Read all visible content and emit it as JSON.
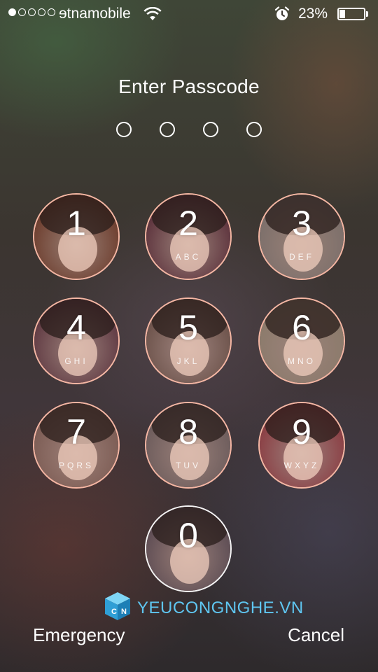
{
  "status_bar": {
    "carrier": "ɘtnamobile",
    "battery_percent": "23%",
    "battery_level": 0.23,
    "signal_bars_filled": 1,
    "signal_bars_total": 5,
    "icons": [
      "wifi-icon",
      "alarm-icon",
      "battery-icon"
    ]
  },
  "title": "Enter Passcode",
  "passcode": {
    "length": 4,
    "entered": 0
  },
  "keypad": [
    {
      "digit": "1",
      "letters": ""
    },
    {
      "digit": "2",
      "letters": "ABC"
    },
    {
      "digit": "3",
      "letters": "DEF"
    },
    {
      "digit": "4",
      "letters": "GHI"
    },
    {
      "digit": "5",
      "letters": "JKL"
    },
    {
      "digit": "6",
      "letters": "MNO"
    },
    {
      "digit": "7",
      "letters": "PQRS"
    },
    {
      "digit": "8",
      "letters": "TUV"
    },
    {
      "digit": "9",
      "letters": "WXYZ"
    },
    {
      "digit": "0",
      "letters": ""
    }
  ],
  "watermark": "YEUCONGNGHE.VN",
  "buttons": {
    "emergency": "Emergency",
    "cancel": "Cancel"
  },
  "colors": {
    "key_ring": "#ffbeaa",
    "watermark": "#5fc6f1",
    "photo_tints": [
      "#6b3a2a",
      "#5a2f3a",
      "#7a6e6a",
      "#5d3640",
      "#6a5048",
      "#8a7a6a",
      "#7a5a52",
      "#6a5a5a",
      "#8a3a40",
      "#5a4a52"
    ]
  }
}
